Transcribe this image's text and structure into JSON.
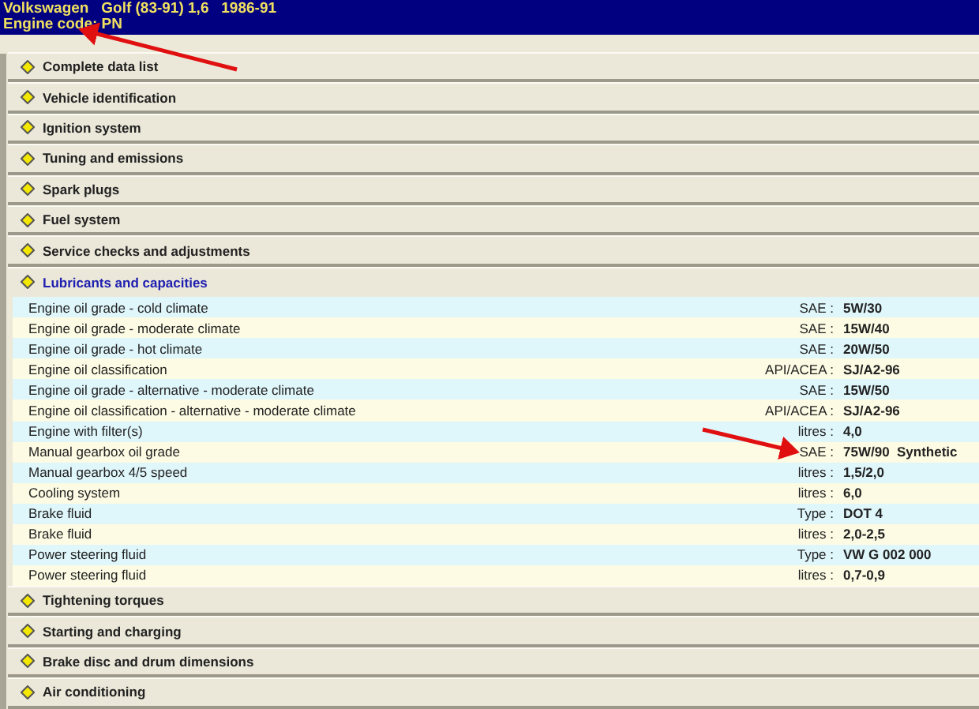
{
  "header": {
    "title": "Volkswagen   Golf (83-91) 1,6   1986-91",
    "engine_code": "Engine code: PN"
  },
  "sections": [
    {
      "label": "Complete data list",
      "expanded": false
    },
    {
      "label": "Vehicle identification",
      "expanded": false
    },
    {
      "label": "Ignition system",
      "expanded": false
    },
    {
      "label": "Tuning and emissions",
      "expanded": false
    },
    {
      "label": "Spark plugs",
      "expanded": false
    },
    {
      "label": "Fuel system",
      "expanded": false
    },
    {
      "label": "Service checks and adjustments",
      "expanded": false
    },
    {
      "label": "Lubricants and capacities",
      "expanded": true,
      "rows": [
        {
          "name": "Engine oil grade - cold climate",
          "unit": "SAE :",
          "value": "5W/30"
        },
        {
          "name": "Engine oil grade - moderate climate",
          "unit": "SAE :",
          "value": "15W/40"
        },
        {
          "name": "Engine oil grade - hot climate",
          "unit": "SAE :",
          "value": "20W/50"
        },
        {
          "name": "Engine oil classification",
          "unit": "API/ACEA :",
          "value": "SJ/A2-96"
        },
        {
          "name": "Engine oil grade - alternative - moderate climate",
          "unit": "SAE :",
          "value": "15W/50"
        },
        {
          "name": "Engine oil classification - alternative - moderate climate",
          "unit": "API/ACEA :",
          "value": "SJ/A2-96"
        },
        {
          "name": "Engine with filter(s)",
          "unit": "litres :",
          "value": "4,0"
        },
        {
          "name": "Manual gearbox oil grade",
          "unit": "SAE :",
          "value": "75W/90  Synthetic"
        },
        {
          "name": "Manual gearbox 4/5 speed",
          "unit": "litres :",
          "value": "1,5/2,0"
        },
        {
          "name": "Cooling system",
          "unit": "litres :",
          "value": "6,0"
        },
        {
          "name": "Brake fluid",
          "unit": "Type :",
          "value": "DOT 4"
        },
        {
          "name": "Brake fluid",
          "unit": "litres :",
          "value": "2,0-2,5"
        },
        {
          "name": "Power steering fluid",
          "unit": "Type :",
          "value": "VW G 002 000"
        },
        {
          "name": "Power steering fluid",
          "unit": "litres :",
          "value": "0,7-0,9"
        }
      ]
    },
    {
      "label": "Tightening torques",
      "expanded": false
    },
    {
      "label": "Starting and charging",
      "expanded": false
    },
    {
      "label": "Brake disc and drum dimensions",
      "expanded": false
    },
    {
      "label": "Air conditioning",
      "expanded": false
    }
  ]
}
